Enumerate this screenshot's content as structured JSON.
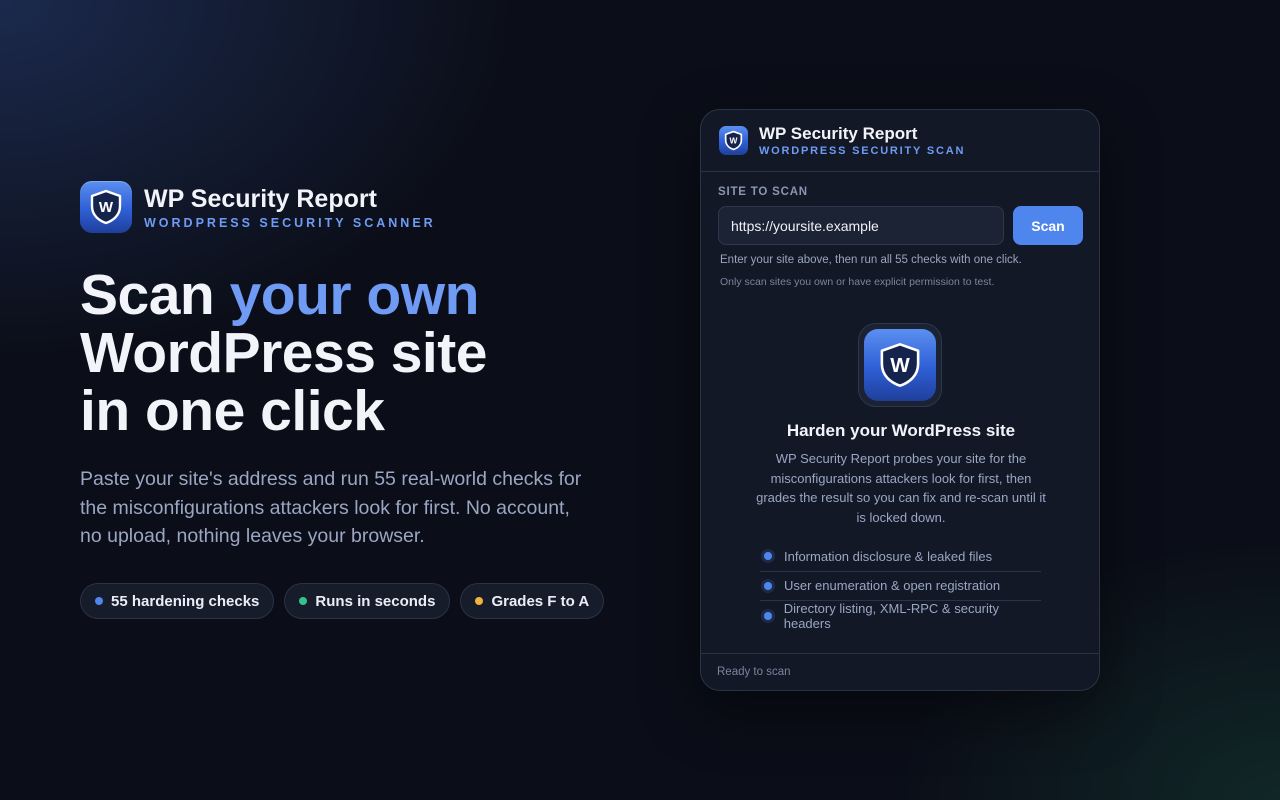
{
  "brand": {
    "title": "WP Security Report",
    "subtitle": "WORDPRESS SECURITY SCANNER",
    "logo_letter": "W"
  },
  "hero": {
    "headline_part1": "Scan ",
    "headline_highlight": "your own",
    "headline_line2": "WordPress site",
    "headline_line3": "in one click",
    "lead": "Paste your site's address and run 55 real-world checks for the misconfigurations attackers look for first. No account, no upload, nothing leaves your browser."
  },
  "pills": [
    {
      "label": "55 hardening checks",
      "color": "#4f86ee"
    },
    {
      "label": "Runs in seconds",
      "color": "#34c38f"
    },
    {
      "label": "Grades F to A",
      "color": "#f0b43c"
    }
  ],
  "card": {
    "title": "WP Security Report",
    "subtitle": "WORDPRESS SECURITY SCAN",
    "site_label": "SITE TO SCAN",
    "url_value": "https://yoursite.example",
    "scan_label": "Scan",
    "hint": "Enter your site above, then run all 55 checks with one click.",
    "permission_note": "Only scan sites you own or have explicit permission to test.",
    "harden_title": "Harden your WordPress site",
    "harden_desc": "WP Security Report probes your site for the misconfigurations attackers look for first, then grades the result so you can fix and re-scan until it is locked down.",
    "checks": [
      "Information disclosure & leaked files",
      "User enumeration & open registration",
      "Directory listing, XML-RPC & security headers"
    ],
    "status": "Ready to scan"
  },
  "colors": {
    "accent": "#6f9bf5",
    "button": "#4f86ee",
    "background": "#0b0e18",
    "card": "#121826"
  }
}
